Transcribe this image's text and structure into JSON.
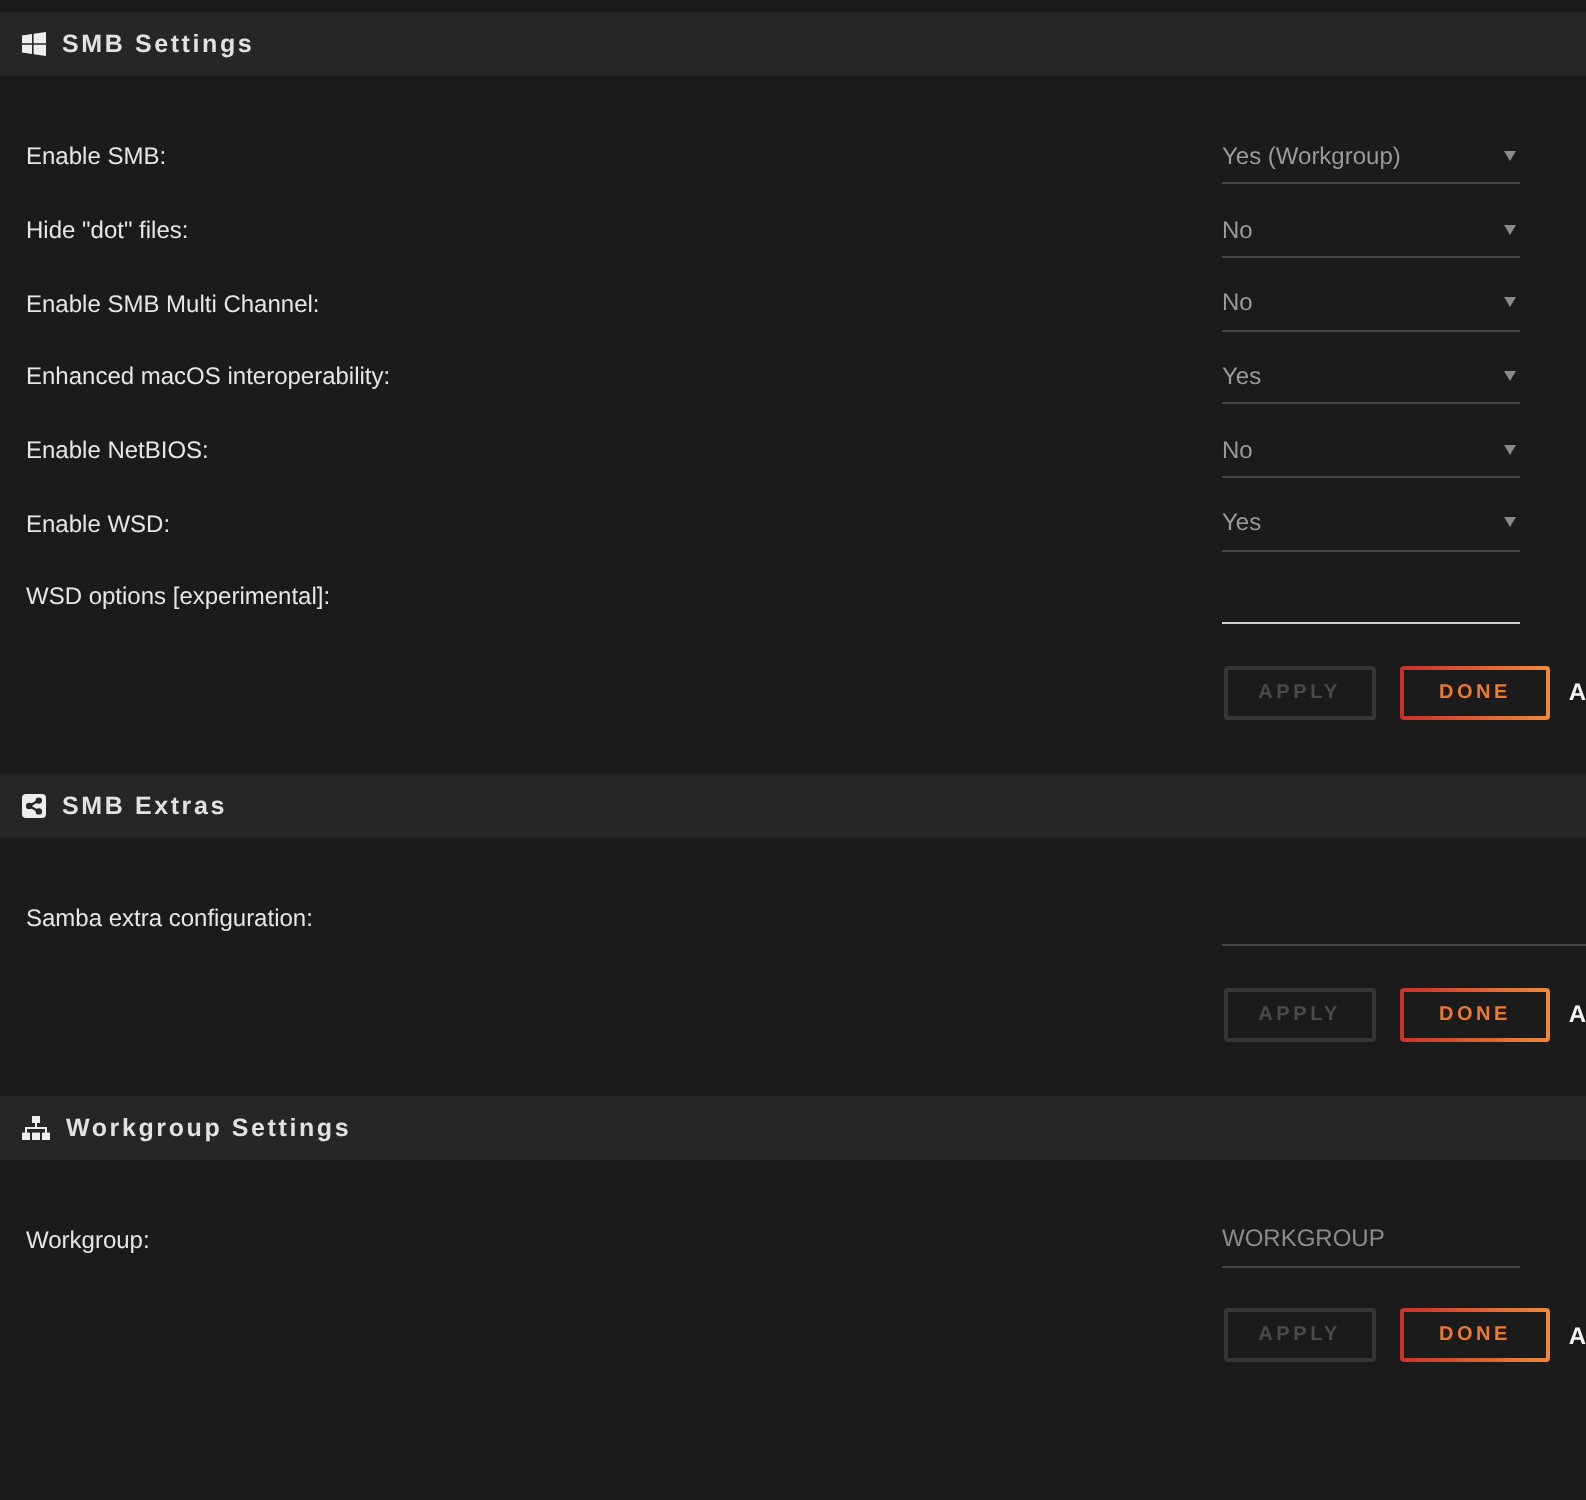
{
  "sections": [
    {
      "title": "SMB Settings",
      "fields": [
        {
          "label": "Enable SMB:",
          "kind": "select",
          "value": "Yes (Workgroup)",
          "focused": false
        },
        {
          "label": "Hide \"dot\" files:",
          "kind": "select",
          "value": "No",
          "focused": false
        },
        {
          "label": "Enable SMB Multi Channel:",
          "kind": "select",
          "value": "No",
          "focused": false
        },
        {
          "label": "Enhanced macOS interoperability:",
          "kind": "select",
          "value": "Yes",
          "focused": false
        },
        {
          "label": "Enable NetBIOS:",
          "kind": "select",
          "value": "No",
          "focused": false
        },
        {
          "label": "Enable WSD:",
          "kind": "select",
          "value": "Yes",
          "focused": false
        },
        {
          "label": "WSD options [experimental]:",
          "kind": "text",
          "focused": true
        }
      ],
      "buttons": [
        {
          "label": "APPLY",
          "disabled": true
        },
        {
          "label": "DONE",
          "disabled": false
        }
      ],
      "trailing_text": "A"
    },
    {
      "title": "SMB Extras",
      "fields": [
        {
          "label": "Samba extra configuration:",
          "kind": "textarea",
          "focused": false
        }
      ],
      "buttons": [
        {
          "label": "APPLY",
          "disabled": true
        },
        {
          "label": "DONE",
          "disabled": false
        }
      ],
      "trailing_text": "A"
    },
    {
      "title": "Workgroup Settings",
      "fields": [
        {
          "label": "Workgroup:",
          "kind": "text",
          "value": "WORKGROUP",
          "focused": false
        }
      ],
      "buttons": [
        {
          "label": "APPLY",
          "disabled": true
        },
        {
          "label": "DONE",
          "disabled": false
        }
      ],
      "trailing_text": "A"
    }
  ]
}
